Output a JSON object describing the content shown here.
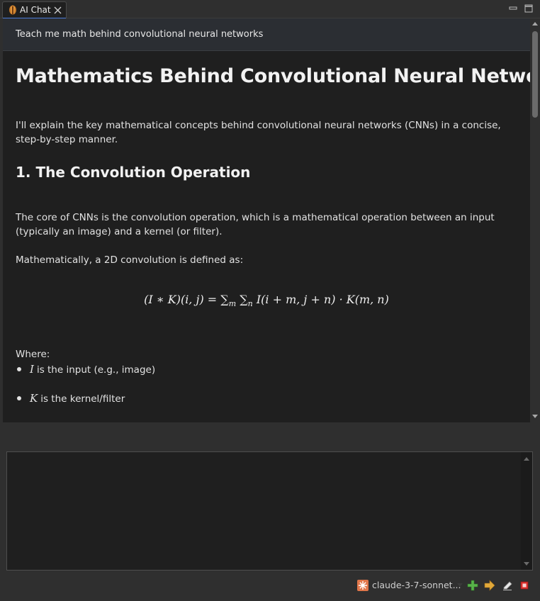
{
  "tab": {
    "title": "AI Chat"
  },
  "prompt": {
    "text": "Teach me math behind convolutional neural networks"
  },
  "response": {
    "heading": "Mathematics Behind Convolutional Neural Networks",
    "intro": "I'll explain the key mathematical concepts behind convolutional neural networks (CNNs) in a concise, step-by-step manner.",
    "section1_heading": "1. The Convolution Operation",
    "section1_para": "The core of CNNs is the convolution operation, which is a mathematical operation between an input (typically an image) and a kernel (or filter).",
    "section1_def": "Mathematically, a 2D convolution is defined as:",
    "formula": {
      "lhs": "(I ∗ K)(i, j) = ∑",
      "sub_m": "m",
      "sum2": " ∑",
      "sub_n": "n",
      "rhs": " I(i + m, j + n) · K(m, n)"
    },
    "where_label": "Where:",
    "bullets": [
      {
        "var": "I",
        "text": "is the input (e.g., image)"
      },
      {
        "var": "K",
        "text": "is the kernel/filter"
      }
    ]
  },
  "input": {
    "value": "",
    "placeholder": ""
  },
  "toolbar": {
    "model_label": "claude-3-7-sonnet...",
    "model_icon": "claude-model-icon",
    "accent_colors": {
      "add": "#58b34a",
      "send": "#e2a93a",
      "stop": "#e0322f",
      "model": "#e0764a",
      "tab_active": "#4c7cd9"
    }
  }
}
